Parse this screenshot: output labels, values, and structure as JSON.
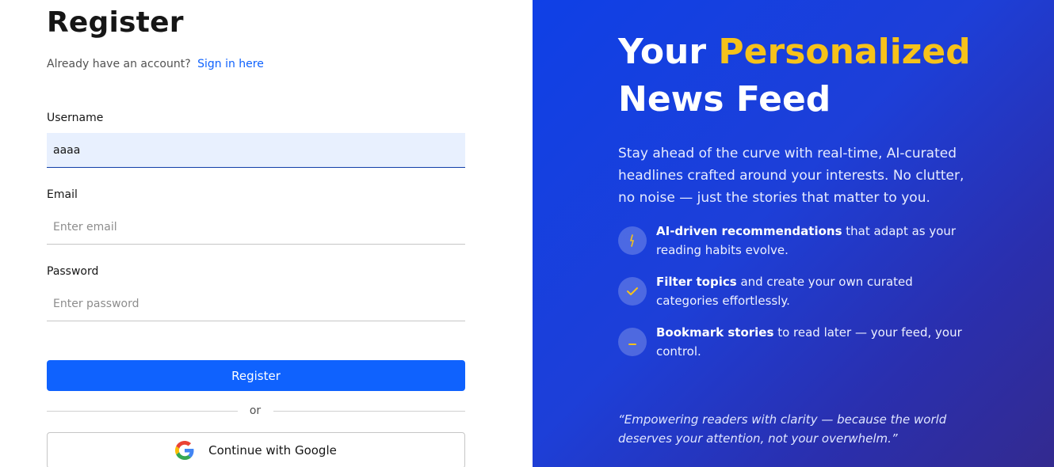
{
  "register": {
    "title": "Register",
    "already_text": "Already have an account?",
    "signin_link": "Sign in here",
    "username_label": "Username",
    "username_value": "aaaa",
    "email_label": "Email",
    "email_placeholder": "Enter email",
    "password_label": "Password",
    "password_placeholder": "Enter password",
    "submit_label": "Register",
    "or_text": "or",
    "google_label": "Continue with Google"
  },
  "hero": {
    "title_part1": "Your ",
    "title_accent": "Personalized",
    "title_part2": "News Feed",
    "lede": "Stay ahead of the curve with real-time, AI-curated headlines crafted around your interests. No clutter, no noise — just the stories that matter to you.",
    "features": [
      {
        "icon": "bulb-icon",
        "bold": "AI-driven recommendations",
        "text": " that adapt as your reading habits evolve."
      },
      {
        "icon": "check-icon",
        "bold": "Filter topics",
        "text": " and create your own curated categories effortlessly."
      },
      {
        "icon": "bookmark-icon",
        "bold": "Bookmark stories",
        "text": " to read later — your feed, your control."
      }
    ],
    "quote": "“Empowering readers with clarity — because the world deserves your attention, not your overwhelm.”"
  },
  "colors": {
    "primary": "#0f62fe",
    "accent": "#f6c21a",
    "panel_start": "#0f40e6",
    "panel_end": "#332a8f"
  }
}
